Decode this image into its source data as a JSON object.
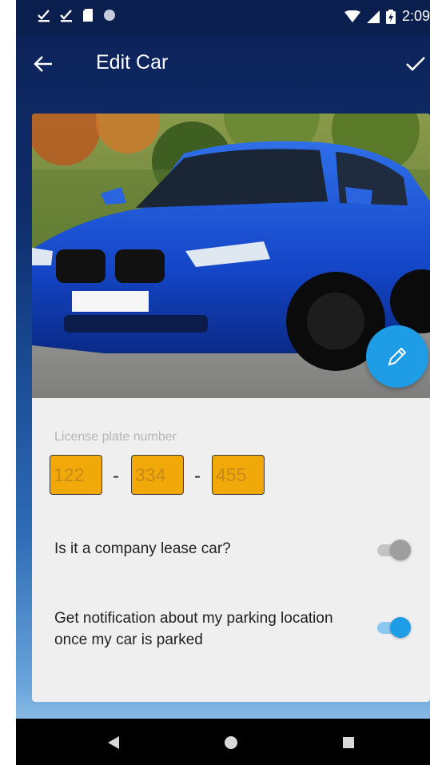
{
  "status_bar": {
    "left_icons": [
      "download-done-icon",
      "download-done-icon",
      "sd-card-icon",
      "circle-dot-icon"
    ],
    "right_icons": [
      "wifi-icon",
      "signal-icon",
      "battery-charging-icon"
    ],
    "time": "2:09"
  },
  "app_bar": {
    "back_icon": "arrow-left-icon",
    "title": "Edit Car",
    "confirm_icon": "check-icon"
  },
  "car_card": {
    "photo": "blue-car-photo",
    "edit_icon": "pencil-icon",
    "license_plate": {
      "label": "License plate number",
      "parts": [
        "122",
        "334",
        "455"
      ],
      "separator": "-"
    },
    "options": [
      {
        "label": "Is it a company lease car?",
        "enabled": false
      },
      {
        "label": "Get notification about my parking location  once my car  is parked",
        "enabled": true
      }
    ]
  },
  "nav_bar": {
    "icons": [
      "back-triangle-icon",
      "home-circle-icon",
      "recents-square-icon"
    ]
  },
  "colors": {
    "accent": "#1e9de6",
    "plate_background": "#f1a90a",
    "header": "#0b1f4f"
  }
}
